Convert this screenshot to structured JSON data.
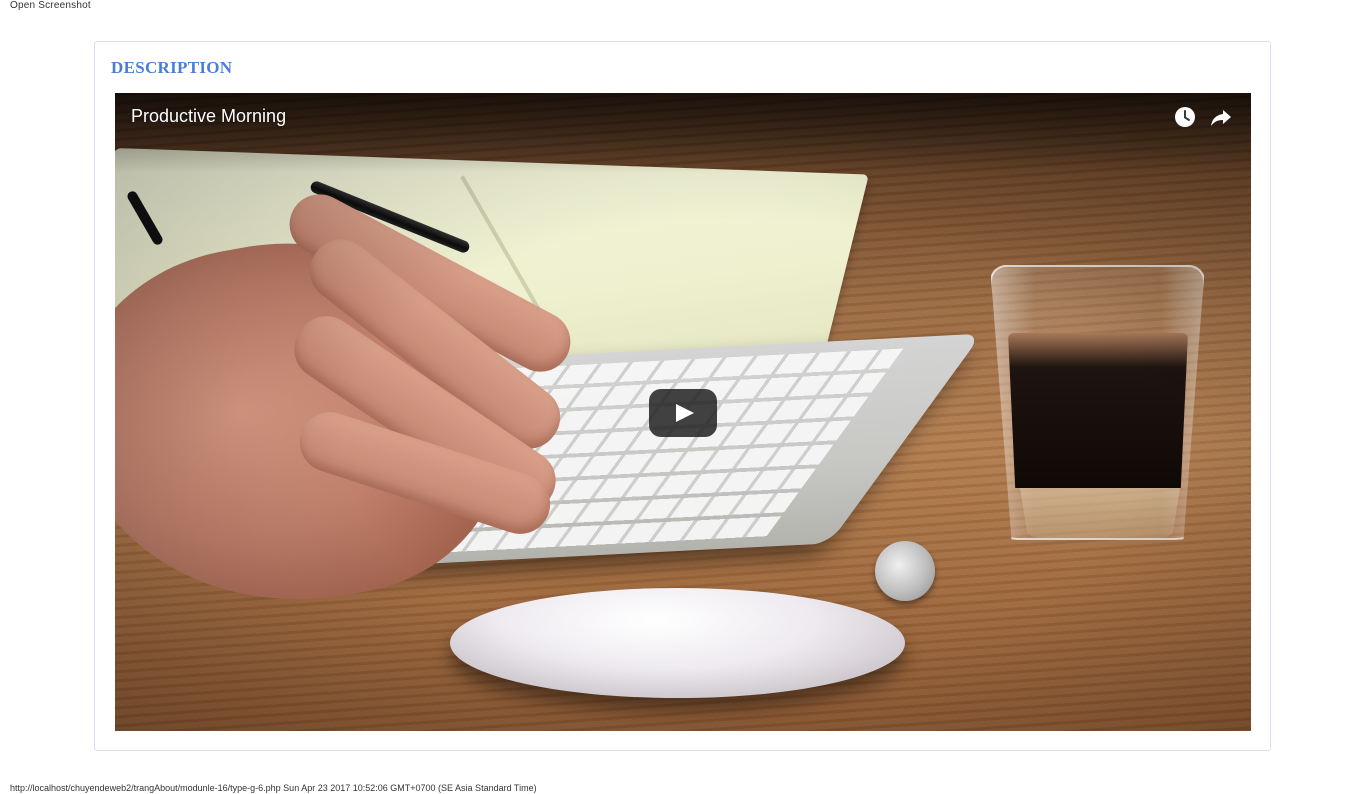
{
  "header": {
    "caption": "Open Screenshot"
  },
  "panel": {
    "title": "DESCRIPTION",
    "title_color": "#4a7fd6",
    "border_color": "#d6e2f2"
  },
  "video": {
    "title": "Productive Morning",
    "icons": {
      "watch_later": "clock-icon",
      "share": "share-icon",
      "play": "play-icon"
    }
  },
  "footer": {
    "caption": "http://localhost/chuyendeweb2/trangAbout/modunle-16/type-g-6.php Sun Apr 23 2017 10:52:06 GMT+0700 (SE Asia Standard Time)"
  }
}
